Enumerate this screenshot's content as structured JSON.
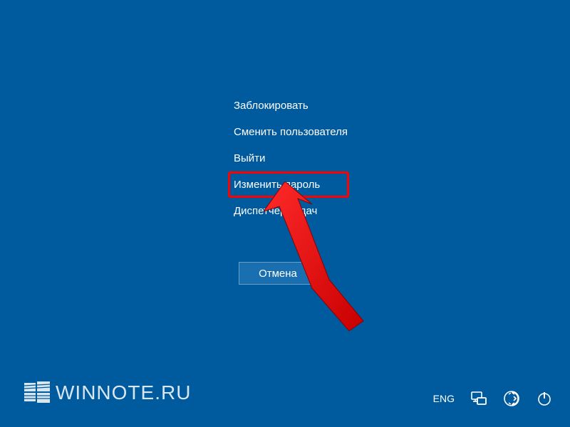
{
  "menu": {
    "items": [
      {
        "label": "Заблокировать",
        "highlighted": false
      },
      {
        "label": "Сменить пользователя",
        "highlighted": false
      },
      {
        "label": "Выйти",
        "highlighted": false
      },
      {
        "label": "Изменить пароль",
        "highlighted": true
      },
      {
        "label": "Диспетчер задач",
        "highlighted": false
      }
    ],
    "cancel_label": "Отмена"
  },
  "footer": {
    "logo_text": "WINNOTE.RU",
    "language": "ENG",
    "icons": {
      "network": "network-icon",
      "ease_of_access": "ease-of-access-icon",
      "power": "power-icon"
    }
  },
  "annotation": {
    "arrow_color": "#ff0000",
    "highlight_color": "#ff0000"
  }
}
